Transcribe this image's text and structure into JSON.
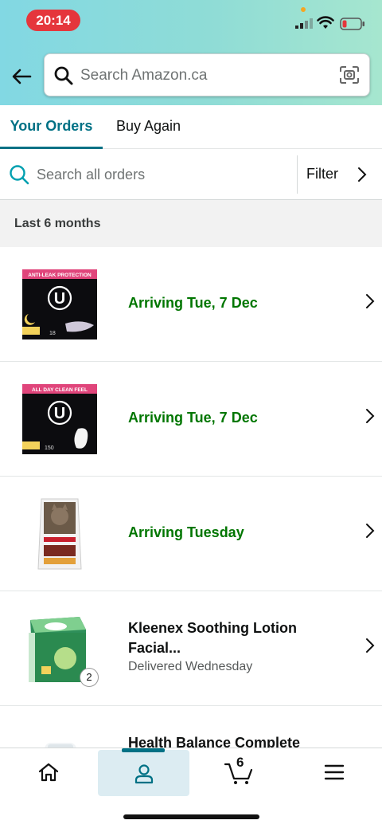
{
  "status_bar": {
    "time": "20:14"
  },
  "header": {
    "search_placeholder": "Search Amazon.ca"
  },
  "tabs": [
    {
      "label": "Your Orders",
      "active": true
    },
    {
      "label": "Buy Again",
      "active": false
    }
  ],
  "order_search": {
    "placeholder": "Search all orders",
    "filter_label": "Filter"
  },
  "section": {
    "label": "Last 6 months"
  },
  "orders": [
    {
      "status": "Arriving Tue, 7 Dec",
      "product_image": "u-by-kotex-overnight-box",
      "pack_text": "ANTI-LEAK PROTECTION"
    },
    {
      "status": "Arriving Tue, 7 Dec",
      "product_image": "u-by-kotex-liners-box",
      "pack_text": "ALL DAY CLEAN FEEL"
    },
    {
      "status": "Arriving Tuesday",
      "product_image": "hills-cat-food-bag"
    },
    {
      "title": "Kleenex Soothing Lotion Facial...",
      "status": "Delivered Wednesday",
      "product_image": "kleenex-tissue-box",
      "quantity": "2"
    },
    {
      "title": "Health Balance Complete",
      "product_image": "supplement-bottle"
    }
  ],
  "bottom_nav": {
    "items": [
      "home-icon",
      "account-icon",
      "cart-icon",
      "menu-icon"
    ],
    "active": "account-icon",
    "cart_count": "6"
  },
  "colors": {
    "accent": "#007185",
    "arriving": "#007600",
    "time_pill": "#e5363c"
  }
}
